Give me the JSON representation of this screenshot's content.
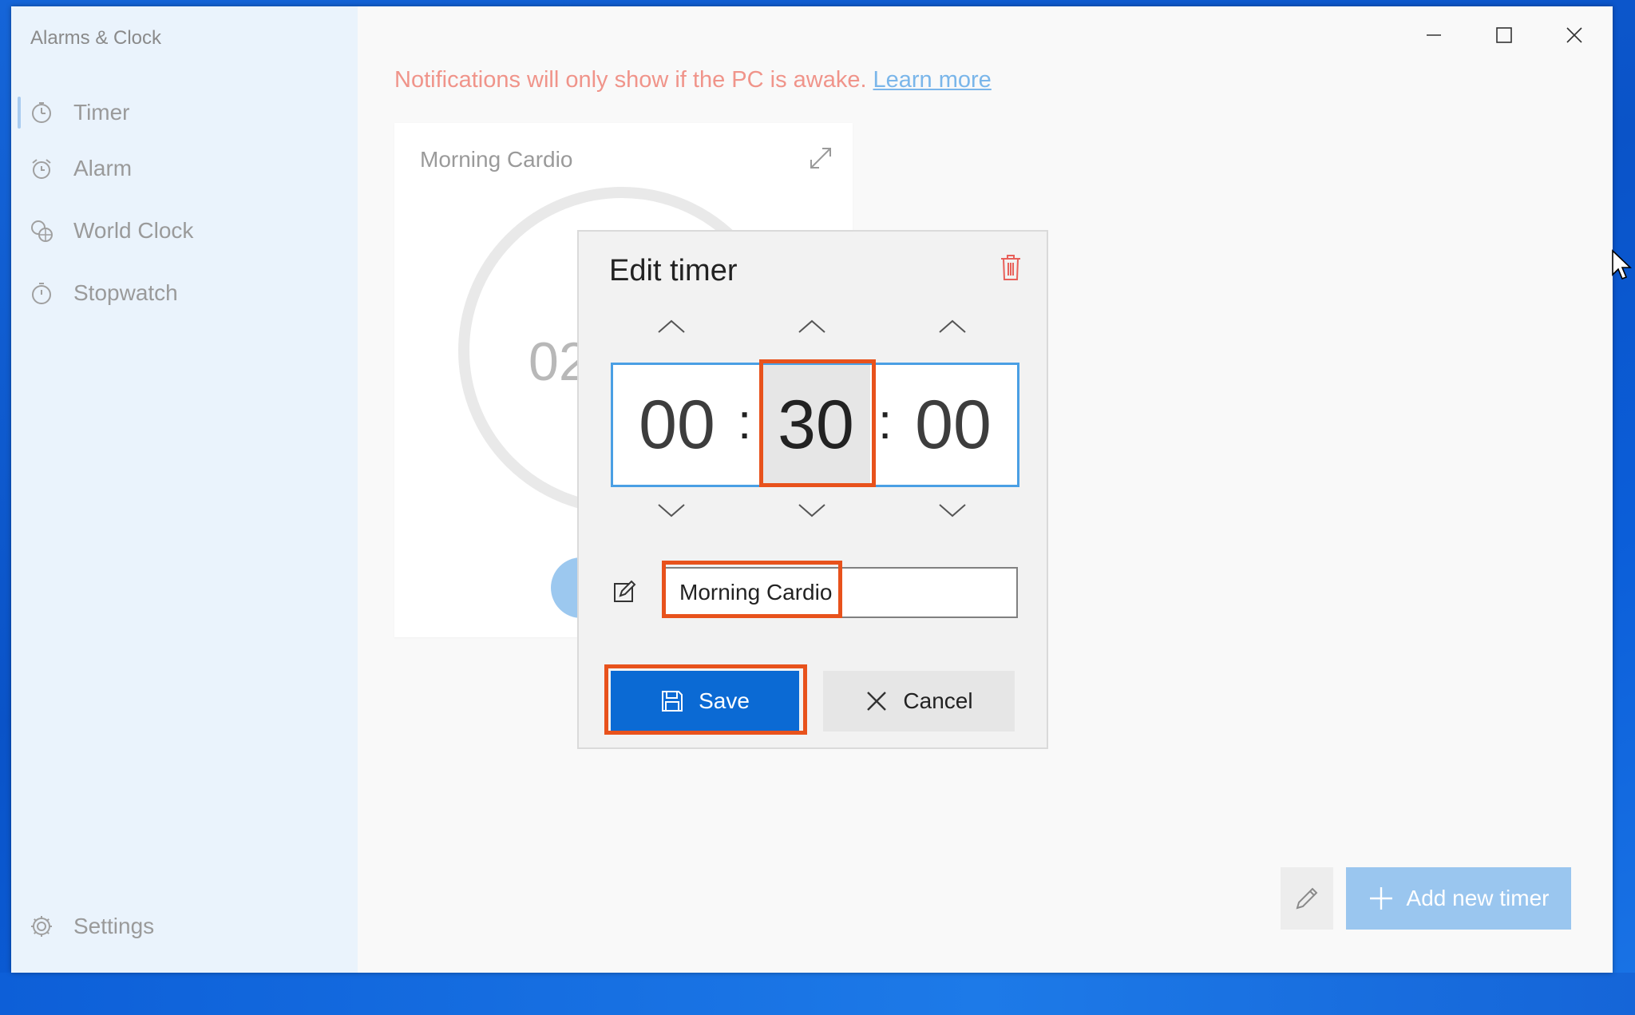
{
  "app": {
    "title": "Alarms & Clock"
  },
  "sidebar": {
    "items": [
      {
        "label": "Timer",
        "icon": "timer-icon",
        "active": true
      },
      {
        "label": "Alarm",
        "icon": "alarm-icon",
        "active": false
      },
      {
        "label": "World Clock",
        "icon": "world-clock-icon",
        "active": false
      },
      {
        "label": "Stopwatch",
        "icon": "stopwatch-icon",
        "active": false
      }
    ],
    "settings_label": "Settings"
  },
  "notice": {
    "text": "Notifications will only show if the PC is awake.",
    "link": "Learn more"
  },
  "timer_card": {
    "title": "Morning Cardio",
    "time_partial": "02"
  },
  "dialog": {
    "title": "Edit timer",
    "hours": "00",
    "minutes": "30",
    "seconds": "00",
    "separator": ":",
    "name_value": "Morning Cardio",
    "save_label": "Save",
    "cancel_label": "Cancel"
  },
  "footer": {
    "add_label": "Add new timer"
  },
  "colors": {
    "accent": "#0b6ad4",
    "highlight": "#e8521c",
    "notice": "#f0948a",
    "link": "#7ab6ea"
  }
}
